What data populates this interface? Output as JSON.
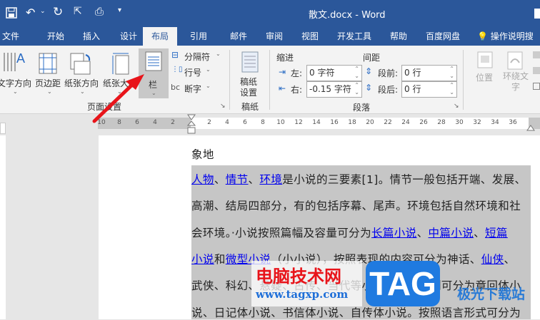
{
  "titlebar": {
    "title": "散文.docx  -  Word",
    "icons": [
      "save-icon",
      "undo-icon",
      "redo-icon",
      "touch-mode-icon",
      "print-preview-icon",
      "customize-icon"
    ]
  },
  "tabs": [
    "文件",
    "开始",
    "插入",
    "设计",
    "布局",
    "引用",
    "邮件",
    "审阅",
    "视图",
    "开发工具",
    "帮助",
    "百度网盘"
  ],
  "tell_me": "操作说明搜",
  "ribbon": {
    "page_setup": {
      "text_direction": "文字方向",
      "margins": "页边距",
      "orientation": "纸张方向",
      "size": "纸张大小",
      "columns": "栏",
      "breaks": "分隔符",
      "line_numbers": "行号",
      "hyphenation": "断字",
      "group": "页面设置"
    },
    "draft": {
      "button": "稿纸设置",
      "group": "稿纸"
    },
    "paragraph": {
      "indent_label": "缩进",
      "spacing_label": "间距",
      "left_label": "左:",
      "left_value": "0 字符",
      "right_label": "右:",
      "right_value": "-0.15 字符",
      "before_label": "段前:",
      "before_value": "0 行",
      "after_label": "段后:",
      "after_value": "0 行",
      "group": "段落"
    },
    "arrange": {
      "position": "位置",
      "wrap": "环绕文字"
    }
  },
  "ruler": {
    "left": [
      "10",
      "8",
      "6",
      "4",
      "2"
    ],
    "right": [
      "2",
      "4",
      "6",
      "8",
      "10",
      "12",
      "14",
      "16",
      "18",
      "20",
      "22",
      "24",
      "26",
      "28",
      "30",
      "32",
      "34",
      "36"
    ]
  },
  "document": {
    "heading": "象地",
    "lines": [
      [
        {
          "t": "人物",
          "l": 1
        },
        {
          "t": "、"
        },
        {
          "t": "情节",
          "l": 1
        },
        {
          "t": "、"
        },
        {
          "t": "环境",
          "l": 1
        },
        {
          "t": "是小说的三要素[1]。情节一般包括开端、发展、"
        }
      ],
      [
        {
          "t": "高潮、结局四部分，有的包括序幕、尾声。环境包括自然环境和社"
        }
      ],
      [
        {
          "t": "会环境。·小说按照篇幅及容量可分为"
        },
        {
          "t": "长篇小说",
          "l": 1
        },
        {
          "t": "、"
        },
        {
          "t": "中篇小说",
          "l": 1
        },
        {
          "t": "、"
        },
        {
          "t": "短篇",
          "l": 1
        }
      ],
      [
        {
          "t": "小说",
          "l": 1
        },
        {
          "t": "和"
        },
        {
          "t": "微型小说",
          "l": 1
        },
        {
          "t": "（小小说），按照表现的内容可分为神话、"
        },
        {
          "t": "仙侠",
          "l": 1
        },
        {
          "t": "、"
        }
      ],
      [
        {
          "t": "武侠、科幻、悬疑、古传、当代等小说，按照体制可分为章回体小"
        }
      ],
      [
        {
          "t": "说、日记体小说、书信体小说、自传体小说。按照语言形式可分为"
        }
      ]
    ]
  },
  "watermark": {
    "site": "电脑技术网",
    "url": "www.tagxp.com",
    "tag": "TAG",
    "brand": "极光下载站"
  },
  "colors": {
    "brand": "#2b579a",
    "link": "#0000ee",
    "selection": "#c6c6c6",
    "arrow": "#e8141a"
  }
}
